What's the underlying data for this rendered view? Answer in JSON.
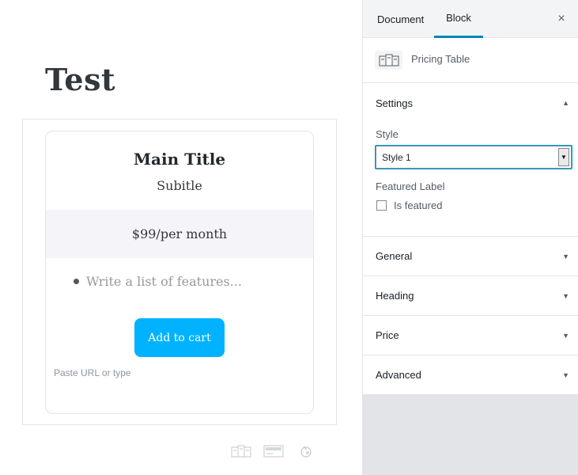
{
  "post": {
    "title": "Test"
  },
  "pricing_table": {
    "main_title": "Main Title",
    "subtitle": "Subitle",
    "price": "$99/per month",
    "features_placeholder": "Write a list of features...",
    "button_label": "Add to cart",
    "url_placeholder": "Paste URL or type",
    "button_color": "#00b2ff",
    "price_band_color": "#f5f5f9"
  },
  "block_toolbar": {
    "icons": [
      "pricing-table-icon",
      "card-icon",
      "paint-icon"
    ]
  },
  "sidebar": {
    "tabs": {
      "document": "Document",
      "block": "Block"
    },
    "active_tab": "Block",
    "close_icon": "×",
    "block_card": {
      "name": "Pricing Table",
      "icon": "pricing-table-icon"
    },
    "settings": {
      "title": "Settings",
      "arrow": "▲",
      "style_label": "Style",
      "style_value": "Style 1",
      "featured_label": "Featured Label",
      "is_featured_label": "Is featured",
      "is_featured_checked": false
    },
    "panels": [
      {
        "title": "General",
        "arrow": "▼"
      },
      {
        "title": "Heading",
        "arrow": "▼"
      },
      {
        "title": "Price",
        "arrow": "▼"
      },
      {
        "title": "Advanced",
        "arrow": "▼"
      }
    ],
    "accent_color": "#0085ba"
  }
}
